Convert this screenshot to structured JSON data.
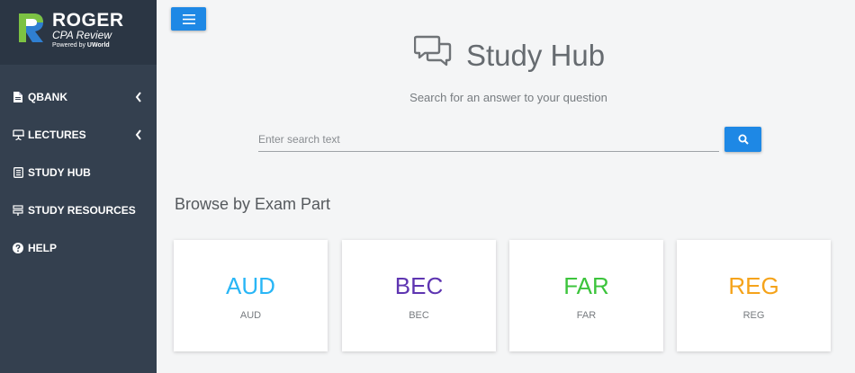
{
  "brand": {
    "title": "ROGER",
    "subtitle": "CPA Review",
    "powered_by": "Powered by",
    "powered_brand": "UWorld"
  },
  "sidebar": {
    "items": [
      {
        "label": "QBANK",
        "icon": "file-icon",
        "has_chevron": true
      },
      {
        "label": "LECTURES",
        "icon": "presentation-icon",
        "has_chevron": true
      },
      {
        "label": "STUDY HUB",
        "icon": "book-icon",
        "has_chevron": false
      },
      {
        "label": "STUDY RESOURCES",
        "icon": "signpost-icon",
        "has_chevron": false
      },
      {
        "label": "HELP",
        "icon": "question-circle-icon",
        "has_chevron": false
      }
    ]
  },
  "header": {
    "title": "Study Hub",
    "subtitle": "Search for an answer to your question"
  },
  "search": {
    "placeholder": "Enter search text",
    "value": ""
  },
  "browse": {
    "title": "Browse by Exam Part",
    "cards": [
      {
        "code": "AUD",
        "label": "AUD",
        "color": "#29b6f6"
      },
      {
        "code": "BEC",
        "label": "BEC",
        "color": "#5e35b1"
      },
      {
        "code": "FAR",
        "label": "FAR",
        "color": "#3cc43c"
      },
      {
        "code": "REG",
        "label": "REG",
        "color": "#f5a31a"
      }
    ]
  },
  "colors": {
    "accent": "#1e88e5",
    "sidebar": "#34404f",
    "logo_green": "#7cc243",
    "logo_blue": "#2f7fd1"
  }
}
